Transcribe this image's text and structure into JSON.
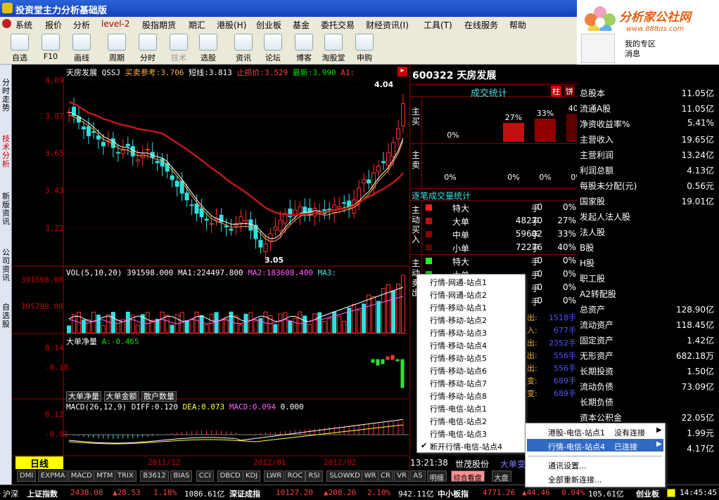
{
  "window": {
    "title": "投资堂主力分析基础版"
  },
  "menu": [
    "系统",
    "报价",
    "分析",
    "level-2",
    "股指期货",
    "期汇",
    "港股(H)",
    "创业板",
    "基金",
    "委托交易",
    "财经资讯(I)",
    "工具(T)",
    "在线服务",
    "帮助"
  ],
  "toolbar": [
    {
      "label": "自选"
    },
    {
      "label": "F10"
    },
    {
      "label": "画线"
    },
    {
      "label": "周期"
    },
    {
      "label": "分时"
    },
    {
      "label": "技术"
    },
    {
      "label": "选股"
    },
    {
      "label": "资讯"
    },
    {
      "label": "论坛"
    },
    {
      "label": "博客"
    },
    {
      "label": "淘股堂"
    },
    {
      "label": "申购"
    }
  ],
  "logo": {
    "brand": "分析家公社网",
    "url": "www.888gs.com"
  },
  "user": {
    "zone": "我的专区",
    "msg": "消息"
  },
  "sidebar_tabs": [
    "分时走势",
    "技术分析",
    "新版资讯",
    "公司资讯",
    "自选股"
  ],
  "chart": {
    "header": {
      "name": "天房发展",
      "code": "QSSJ",
      "ref": "买卖参考:3.706",
      "short": "短线:3.813",
      "stoploss": "止损价:3.529",
      "latest": "最新:3.990",
      "a1": "A1:"
    },
    "price_ticks": [
      "4.09",
      "3.87",
      "3.65",
      "3.43",
      "3.22"
    ],
    "hi_label": "4.04",
    "lo_label": "3.05",
    "vol_header": {
      "vol": "VOL(5,10,20) 391598.000",
      "ma1": "MA1:224497.800",
      "ma2": "MA2:183608.400",
      "ma3": "MA3:"
    },
    "vol_ticks": [
      "391598.00",
      "195799.00"
    ],
    "netbig_header": {
      "name": "大单净量",
      "a": "A:-0.465"
    },
    "net_ticks": [
      "0.14",
      "-0.18"
    ],
    "ind_tabs": [
      "大单净量",
      "大单金额",
      "散户数量"
    ],
    "macd_header": {
      "macd": "MACD(26,12,9) DIFF:0.120",
      "dea": "DEA:0.073",
      "m": "MACD:0.094",
      "z": "0.000"
    },
    "macd_ticks": [
      "0.12",
      "-0.01"
    ],
    "period": "日线",
    "dates": [
      "2011/12",
      "2012/01",
      "2012/02"
    ]
  },
  "right": {
    "code": "600322",
    "name": "天房发展",
    "deal_title": "成交统计",
    "btn1": "柱",
    "btn2": "饼",
    "buy_label": "主买",
    "sell_label": "主卖",
    "buy_pcts": [
      "0%",
      "27%",
      "33%",
      "40%"
    ],
    "sell_pcts": [
      "0%",
      "0%",
      "0%",
      "0%"
    ],
    "stat_title": "逐笔成交量统计",
    "active_buy": "主动买入",
    "active_sell": "主动卖出",
    "rows_buy": [
      {
        "t": "特大",
        "v": "0",
        "u": "手",
        "p": "0%"
      },
      {
        "t": "大单",
        "v": "48270",
        "u": "手",
        "p": "27%"
      },
      {
        "t": "中单",
        "v": "59602",
        "u": "手",
        "p": "33%"
      },
      {
        "t": "小单",
        "v": "72276",
        "u": "手",
        "p": "40%"
      }
    ],
    "rows_sell": [
      {
        "t": "特大",
        "v": "0",
        "u": "手",
        "p": "0%"
      },
      {
        "t": "大单",
        "v": "0",
        "u": "手",
        "p": "0%"
      },
      {
        "t": "中单",
        "v": "0",
        "u": "手",
        "p": "0%"
      },
      {
        "t": "小单",
        "v": "0",
        "u": "手",
        "p": "0%"
      }
    ],
    "flow_rows": [
      {
        "l": "出:",
        "v": "1518手"
      },
      {
        "l": "入:",
        "v": "677手"
      },
      {
        "l": "出:",
        "v": "2352手"
      },
      {
        "l": "出:",
        "v": "556手"
      },
      {
        "l": "出:",
        "v": "556手"
      },
      {
        "l": "变:",
        "v": "689手"
      },
      {
        "l": "变:",
        "v": "689手"
      }
    ],
    "time": "13:21:38",
    "broker": "世茂股份",
    "tail": "大单变"
  },
  "fundamentals": [
    {
      "k": "总股本",
      "v": "11.05亿"
    },
    {
      "k": "流通A股",
      "v": "11.05亿"
    },
    {
      "k": "净资收益率%",
      "v": "5.41%"
    },
    {
      "k": "主营收入",
      "v": "19.65亿"
    },
    {
      "k": "主营利润",
      "v": "13.24亿"
    },
    {
      "k": "利润总额",
      "v": "4.13亿"
    },
    {
      "k": "每股未分配(元)",
      "v": "0.56元"
    },
    {
      "k": "国家股",
      "v": "19.01亿"
    },
    {
      "k": "发起人法人股",
      "v": ""
    },
    {
      "k": "法人股",
      "v": ""
    },
    {
      "k": "B股",
      "v": ""
    },
    {
      "k": "H股",
      "v": ""
    },
    {
      "k": "职工股",
      "v": ""
    },
    {
      "k": "A2转配股",
      "v": ""
    },
    {
      "k": "总资产",
      "v": "128.90亿"
    },
    {
      "k": "流动资产",
      "v": "118.45亿"
    },
    {
      "k": "固定资产",
      "v": "1.42亿"
    },
    {
      "k": "无形资产",
      "v": "682.18万"
    },
    {
      "k": "长期投资",
      "v": "1.50亿"
    },
    {
      "k": "流动负债",
      "v": "73.09亿"
    },
    {
      "k": "长期负债",
      "v": ""
    },
    {
      "k": "资本公积金",
      "v": "22.05亿"
    },
    {
      "k": "",
      "v": "1.99元"
    },
    {
      "k": "",
      "v": "4.17亿"
    }
  ],
  "popup": [
    "行情-网通-站点1",
    "行情-网通-站点2",
    "行情-移动-站点1",
    "行情-移动-站点2",
    "行情-移动-站点3",
    "行情-移动-站点4",
    "行情-移动-站点5",
    "行情-移动-站点6",
    "行情-移动-站点7",
    "行情-移动-站点8",
    "行情-电信-站点1",
    "行情-电信-站点2",
    "行情-电信-站点3",
    "断开行情-电信-站点4"
  ],
  "submenu": {
    "a": "港股-电信-站点1",
    "a_s": "没有连接",
    "b": "行情-电信-站点4",
    "b_s": "已连接",
    "c": "通讯设置...",
    "d": "全部重新连接..."
  },
  "bottom_tabs": [
    "DMI",
    "EXPMA",
    "MACD",
    "MTM",
    "TRIX",
    "B3612",
    "BIAS",
    "CCI",
    "DBCD",
    "KDJ",
    "LWR",
    "ROC",
    "RSI",
    "SLOWKD",
    "WR",
    "CR",
    "VR",
    "AS",
    "明细",
    "综合看盘",
    "大盘"
  ],
  "status": {
    "market": "沪深",
    "sh_name": "上证指数",
    "sh_val": "2438.08",
    "sh_chg": "▲28.53",
    "sh_pct": "1.18%",
    "sh_amt": "1086.61亿",
    "sz_name": "深证成指",
    "sz_val": "10127.20",
    "sz_chg": "▲208.26",
    "sz_pct": "2.10%",
    "sz_amt": "942.11亿",
    "sm_name": "中小板指",
    "sm_val": "4771.26",
    "sm_chg": "▲44.46",
    "sm_pct": "0.94%",
    "sm_amt": "105.61亿",
    "cy": "创业板",
    "time": "14:45:45"
  },
  "colors": {
    "up": "#ff3030",
    "down": "#30e0e0",
    "ma_slow": "#c01818",
    "bar_red": "#d01010"
  }
}
